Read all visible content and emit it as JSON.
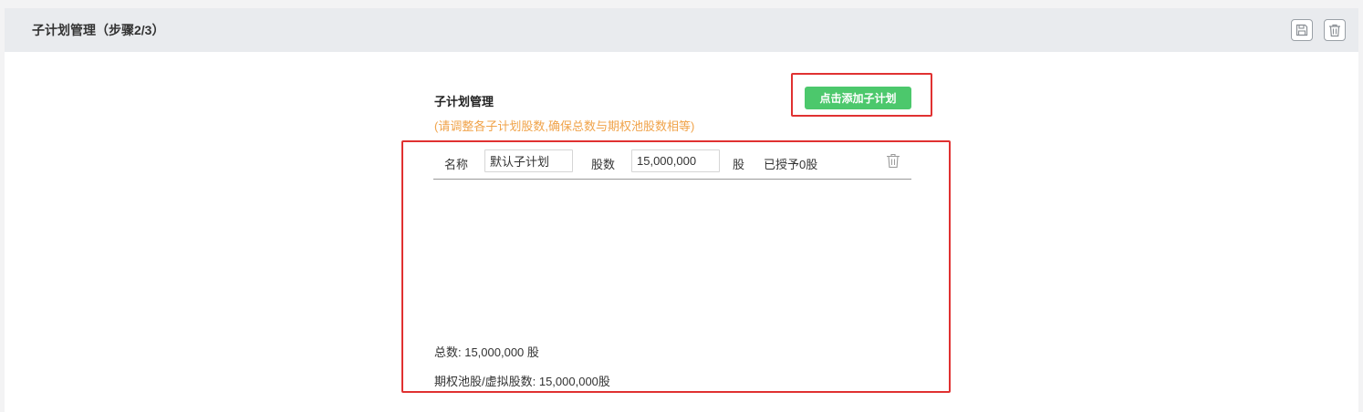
{
  "header": {
    "title": "子计划管理（步骤2/3）",
    "save_icon": "save-icon",
    "delete_icon": "trash-icon"
  },
  "section": {
    "title": "子计划管理",
    "hint": "(请调整各子计划股数,确保总数与期权池股数相等)",
    "add_button_label": "点击添加子计划"
  },
  "subplans": [
    {
      "name_label": "名称",
      "name_value": "默认子计划",
      "shares_label": "股数",
      "shares_value": "15,000,000",
      "unit": "股",
      "granted": "已授予0股"
    }
  ],
  "summary": {
    "total": "总数: 15,000,000 股",
    "pool": "期权池股/虚拟股数: 15,000,000股"
  },
  "colors": {
    "accent_green": "#4cc86c",
    "hint_orange": "#f0a34a",
    "highlight_red": "#e03131"
  }
}
